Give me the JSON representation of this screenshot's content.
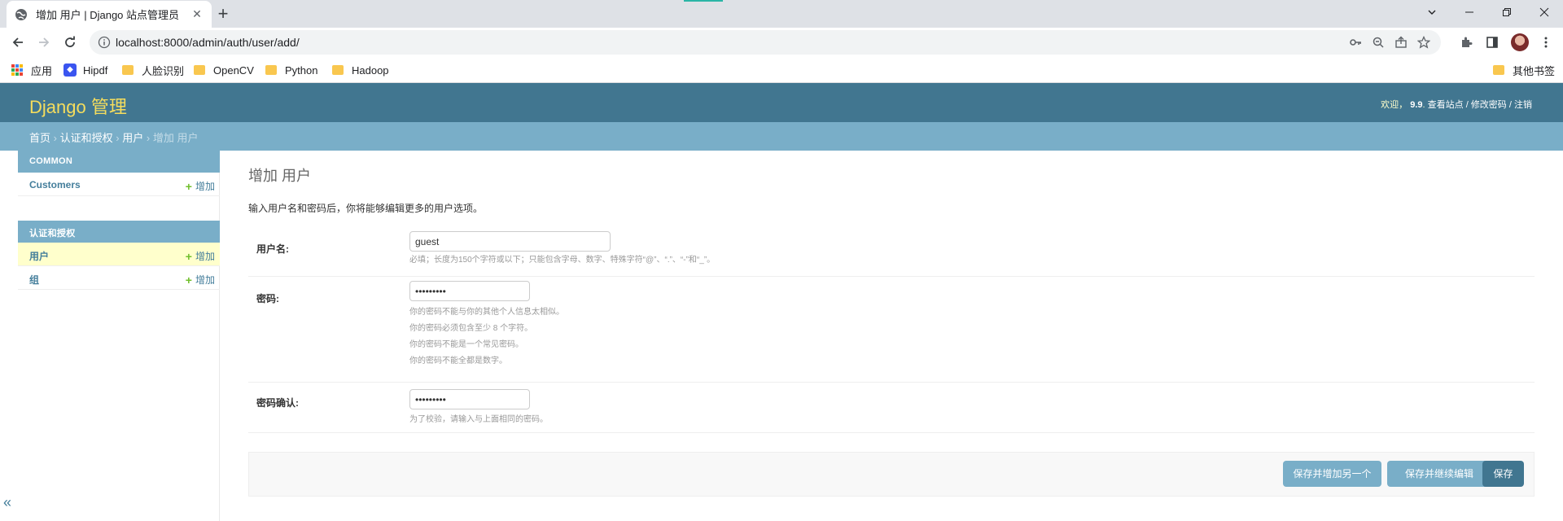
{
  "browser": {
    "tab_title": "增加 用户 | Django 站点管理员",
    "url": "localhost:8000/admin/auth/user/add/",
    "bookmarks": [
      "应用",
      "Hipdf",
      "人脸识别",
      "OpenCV",
      "Python",
      "Hadoop"
    ],
    "other_bookmarks": "其他书签"
  },
  "header": {
    "brand": "Django 管理",
    "welcome": "欢迎，",
    "username": "9.9",
    "view_site": "查看站点",
    "change_password": "修改密码",
    "logout": "注销",
    "sep": "/"
  },
  "breadcrumbs": {
    "home": "首页",
    "app": "认证和授权",
    "model": "用户",
    "current": "增加 用户",
    "sep": "›"
  },
  "sidebar": {
    "modules": [
      {
        "caption": "COMMON",
        "rows": [
          {
            "label": "Customers",
            "add": "增加",
            "selected": false
          }
        ]
      },
      {
        "caption": "认证和授权",
        "rows": [
          {
            "label": "用户",
            "add": "增加",
            "selected": true
          },
          {
            "label": "组",
            "add": "增加",
            "selected": false
          }
        ]
      }
    ],
    "collapse": "«"
  },
  "form": {
    "title": "增加 用户",
    "intro": "输入用户名和密码后，你将能够编辑更多的用户选项。",
    "username": {
      "label": "用户名:",
      "value": "guest",
      "help": "必填；长度为150个字符或以下；只能包含字母、数字、特殊字符“@”、“.”、“-”和“_”。"
    },
    "password1": {
      "label": "密码:",
      "value": "•••••••••",
      "help": [
        "你的密码不能与你的其他个人信息太相似。",
        "你的密码必须包含至少 8 个字符。",
        "你的密码不能是一个常见密码。",
        "你的密码不能全都是数字。"
      ]
    },
    "password2": {
      "label": "密码确认:",
      "value": "•••••••••",
      "help": "为了校验，请输入与上面相同的密码。"
    }
  },
  "submit": {
    "save_add_another": "保存并增加另一个",
    "save_continue": "保存并继续编辑",
    "save": "保存"
  },
  "colors": {
    "header_bg": "#417690",
    "breadcrumbs_bg": "#79aec8",
    "brand": "#f5dd5d",
    "link": "#447e9b",
    "selected_row": "#ffffcc",
    "add_plus": "#70bf2b"
  }
}
